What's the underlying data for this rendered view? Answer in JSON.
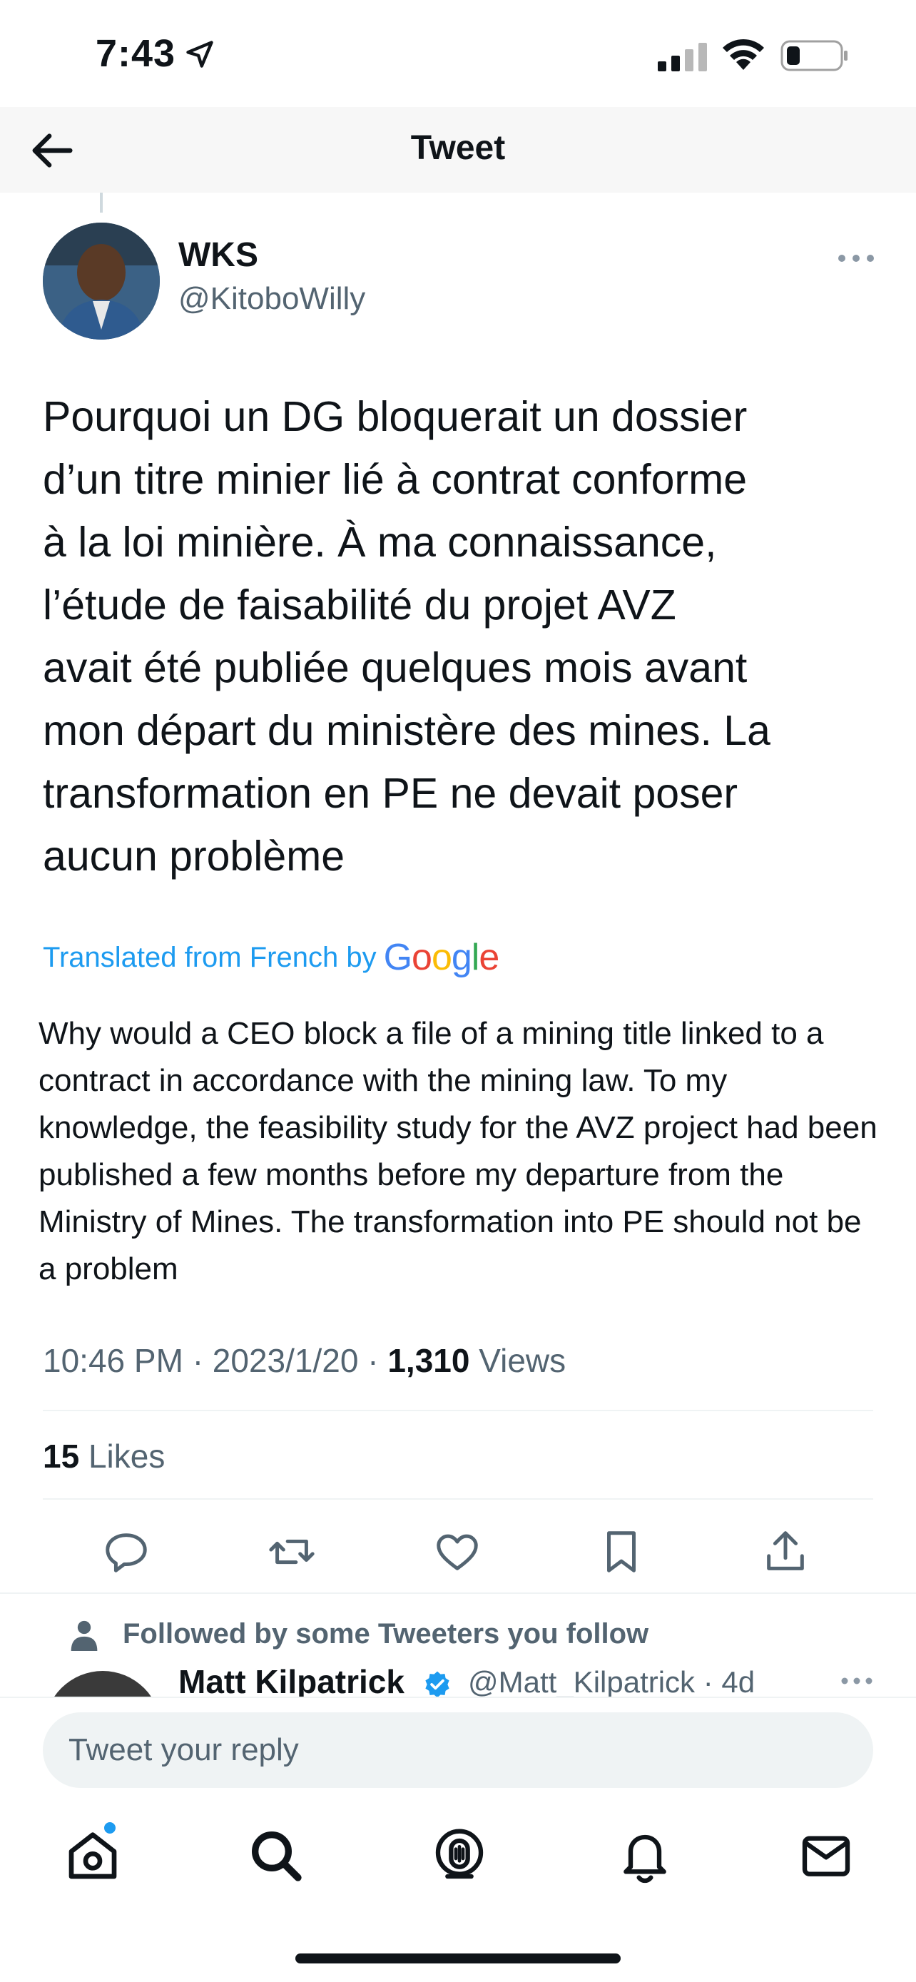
{
  "status_bar": {
    "time": "7:43"
  },
  "nav": {
    "title": "Tweet"
  },
  "tweet": {
    "author_name": "WKS",
    "author_handle": "@KitoboWilly",
    "text": "Pourquoi un DG bloquerait un dossier\nd’un titre minier lié à contrat conforme\nà la loi minière. À ma connaissance,\nl’étude de faisabilité du projet AVZ\navait été publiée quelques mois avant\nmon départ du ministère des mines. La\ntransformation en PE ne devait poser\naucun problème",
    "translated_label": "Translated from French by",
    "translator_brand": "Google",
    "translation": "Why would a CEO block a file of a mining title linked to a contract in accordance with the mining law. To my knowledge, the feasibility study for the AVZ project had been published a few months before my departure from the Ministry of Mines. The transformation into PE should not be a problem",
    "time": "10:46 PM",
    "date": "2023/1/20",
    "separator": "·",
    "views_count": "1,310",
    "views_label": "Views",
    "likes_count": "15",
    "likes_label": "Likes"
  },
  "actions": {
    "icons": [
      "reply-icon",
      "retweet-icon",
      "like-icon",
      "bookmark-icon",
      "share-icon"
    ]
  },
  "reply_section": {
    "followed_text": "Followed by some Tweeters you follow",
    "reply_author_name": "Matt Kilpatrick",
    "reply_author_handle": "@Matt_Kilpatrick",
    "reply_age": "4d"
  },
  "reply_bar": {
    "placeholder": "Tweet your reply"
  },
  "tabbar": {
    "tabs": [
      "home-icon",
      "search-icon",
      "spaces-icon",
      "notifications-icon",
      "messages-icon"
    ]
  },
  "colors": {
    "accent": "#1d9bf0",
    "text": "#0f1419",
    "secondary": "#536471"
  }
}
